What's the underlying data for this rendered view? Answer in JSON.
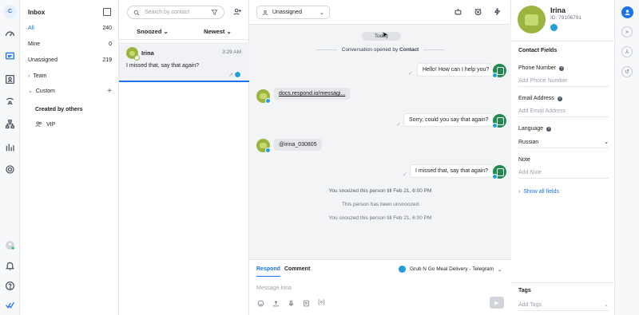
{
  "rail": {
    "account_initial": "C",
    "icons": [
      "dashboard-icon",
      "chat-icon",
      "contact-card-icon",
      "broadcast-icon",
      "workflow-icon",
      "reports-icon",
      "settings-icon",
      "user-icon",
      "bell-icon",
      "help-icon",
      "brand-logo-icon"
    ]
  },
  "inbox_menu": {
    "title": "Inbox",
    "items": [
      {
        "label": "All",
        "count": "240"
      },
      {
        "label": "Mine",
        "count": "0"
      },
      {
        "label": "Unassigned",
        "count": "219"
      }
    ],
    "team_label": "Team",
    "custom_label": "Custom",
    "created_by_others": "Created by others",
    "vip_label": "VIP"
  },
  "list": {
    "search_placeholder": "Search by contact",
    "filter_status": "Snoozed",
    "sort_order": "Newest",
    "conversation": {
      "name": "Irina",
      "time": "3:29 AM",
      "preview": "I missed that, say that again?"
    }
  },
  "chat": {
    "assignee": "Unassigned",
    "date_chip": "Today",
    "opened_prefix": "Conversation opened by",
    "opened_by": "Contact",
    "messages": [
      {
        "text": "Hello! How can I help you?"
      },
      {
        "text": "docs.respond.io/messagi..."
      },
      {
        "text": "Sorry, could you say that again?"
      },
      {
        "text": "@irina_030805"
      },
      {
        "text": "I missed that, say that again?"
      }
    ],
    "system_events": [
      "You snoozed this person till Feb 21, 6:00 PM",
      "This person has been unsnoozed",
      "You snoozed this person till Feb 21, 6:00 PM"
    ],
    "compose": {
      "tab_respond": "Respond",
      "tab_comment": "Comment",
      "channel": "Grub N Go Meal Delivery - Telegram",
      "placeholder": "Message Irina"
    }
  },
  "contact": {
    "name": "Irina",
    "id_text": "ID: 79106791",
    "section_title": "Contact Fields",
    "fields": [
      {
        "label": "Phone Number",
        "placeholder": "Add Phone Number"
      },
      {
        "label": "Email Address",
        "placeholder": "Add Email Address"
      },
      {
        "label": "Language",
        "value": "Russian"
      },
      {
        "label": "Note",
        "placeholder": "Add Note"
      }
    ],
    "show_all": "Show all fields",
    "tags_title": "Tags",
    "tags_placeholder": "Add Tags"
  },
  "colors": {
    "accent": "#1a73e8",
    "telegram": "#229ed9",
    "bot_green": "#1f8a4c",
    "avatar_green": "#9bb33f"
  }
}
